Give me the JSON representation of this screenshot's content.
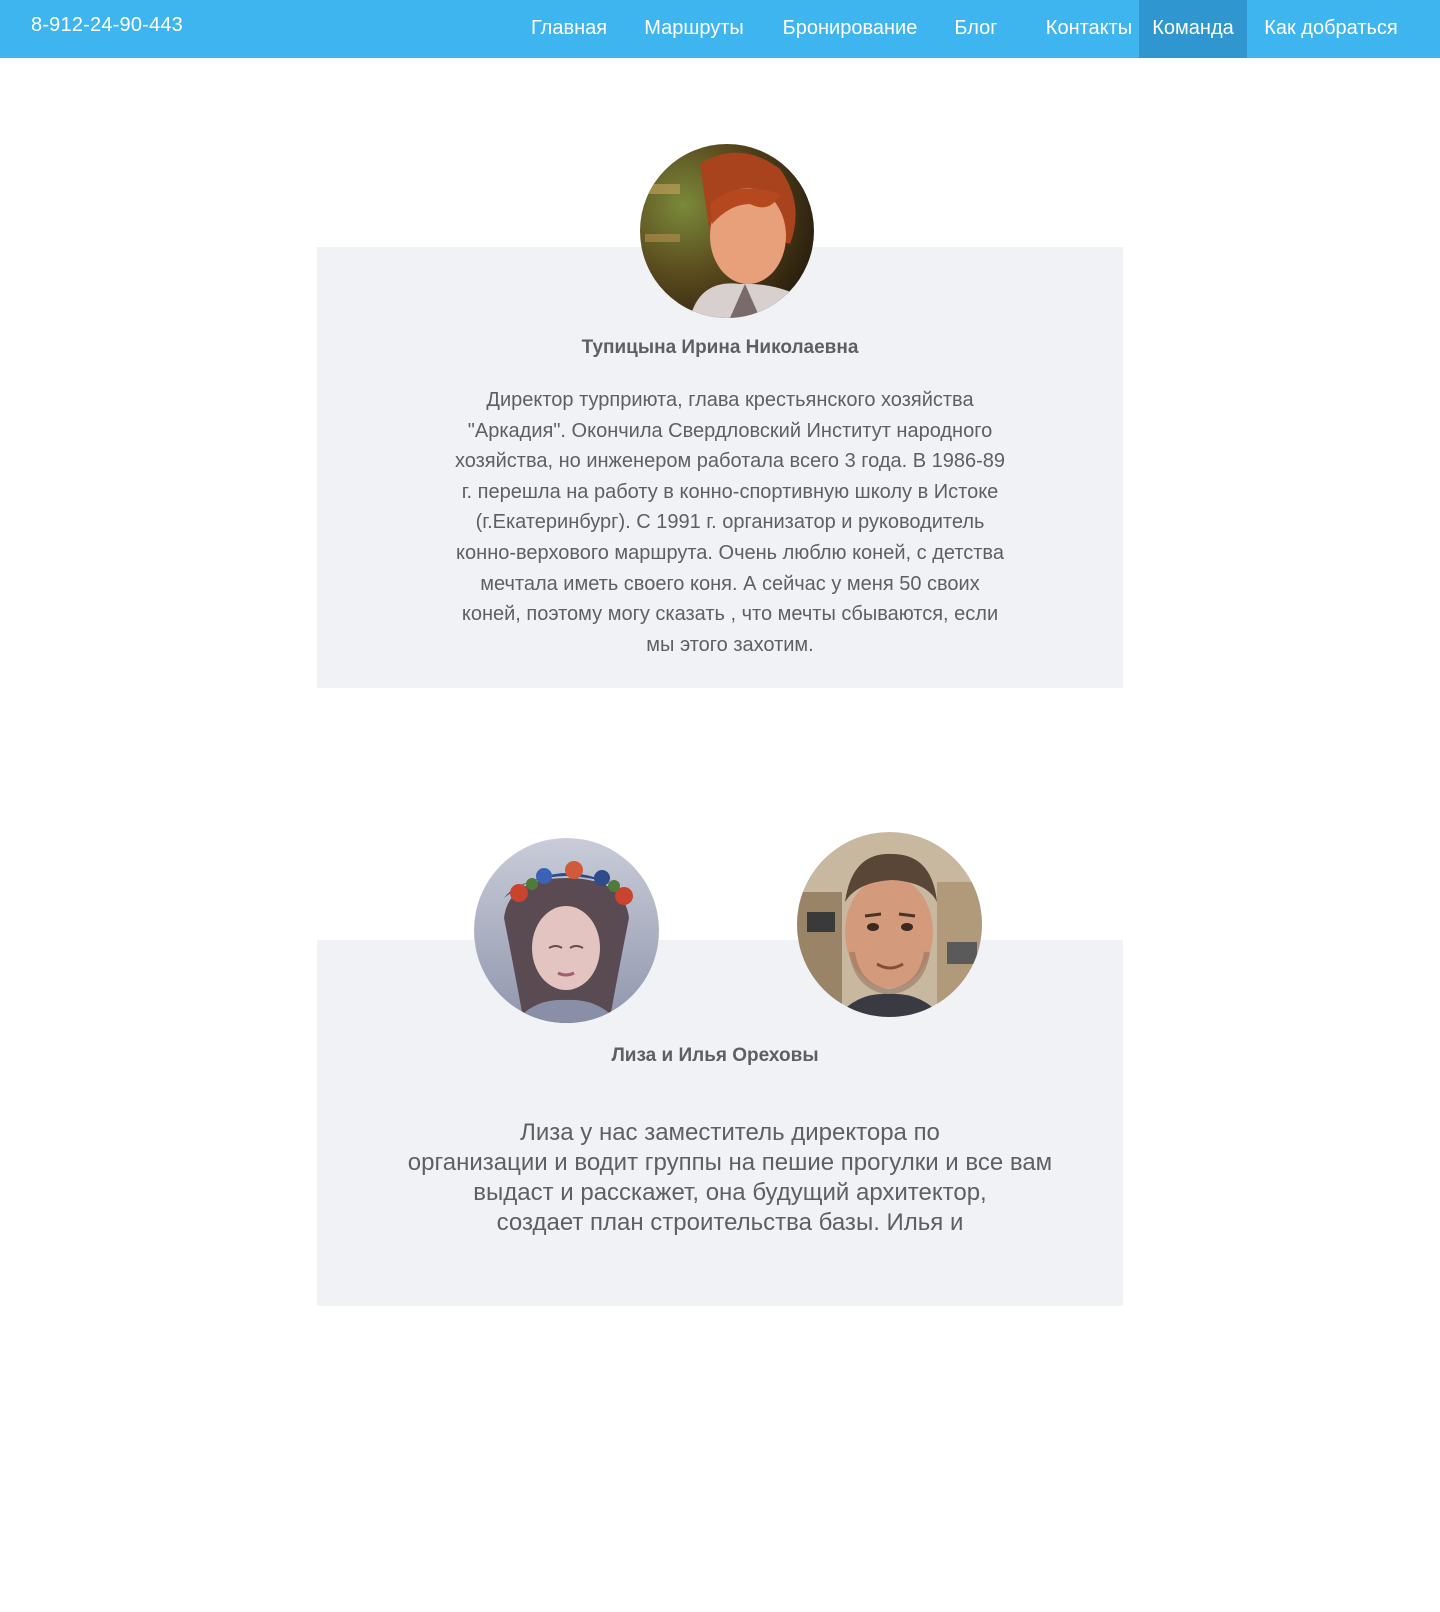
{
  "header": {
    "phone": "8-912-24-90-443",
    "nav": [
      {
        "label": "Главная",
        "active": false
      },
      {
        "label": "Маршруты",
        "active": false
      },
      {
        "label": "Бронирование",
        "active": false
      },
      {
        "label": "Блог",
        "active": false
      },
      {
        "label": "Контакты",
        "active": false
      },
      {
        "label": "Команда",
        "active": true
      },
      {
        "label": "Как добраться",
        "active": false
      }
    ]
  },
  "team": [
    {
      "name": "Тупицына Ирина Николаевна",
      "bio_lines": [
        "Директор турприюта, глава крестьянского хозяйства",
        "\"Аркадия\". Окончила Свердловский Институт народного",
        "хозяйства, но инженером работала всего 3 года. В 1986-89",
        "г. перешла на работу в конно-спортивную школу в Истоке",
        "(г.Екатеринбург). С 1991 г. организатор и руководитель",
        "конно-верхового маршрута. Очень люблю коней, с детства",
        "мечтала иметь своего коня. А сейчас у меня 50 своих",
        "коней, поэтому могу сказать , что мечты сбываются, если",
        "мы этого захотим."
      ]
    },
    {
      "name": "Лиза и Илья Ореховы",
      "bio_lines": [
        "Лиза у нас заместитель директора по",
        "организации и водит группы на пешие прогулки и все вам",
        "выдаст и расскажет, она будущий архитектор,",
        "создает план  строительства базы. Илья и"
      ]
    }
  ],
  "colors": {
    "topbar": "#3fb5ef",
    "nav_active": "#2f96cf",
    "card_bg": "#f1f2f6",
    "text": "#5f5f63"
  }
}
